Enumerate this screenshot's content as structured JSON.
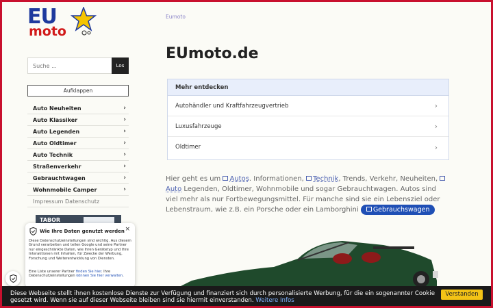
{
  "logo": {
    "line1": "EU",
    "line2": "moto"
  },
  "search": {
    "placeholder": "Suche ...",
    "button": "Los"
  },
  "sidebar": {
    "expand_label": "Aufklappen",
    "items": [
      {
        "label": "Auto Neuheiten"
      },
      {
        "label": "Auto Klassiker"
      },
      {
        "label": "Auto Legenden"
      },
      {
        "label": "Auto Oldtimer"
      },
      {
        "label": "Auto Technik"
      },
      {
        "label": "Straßenverkehr"
      },
      {
        "label": "Gebrauchtwagen"
      },
      {
        "label": "Wohnmobile Camper"
      },
      {
        "label": "Impressum Datenschutz"
      }
    ],
    "ad_text": "TABOR"
  },
  "main": {
    "breadcrumb": "Eumoto",
    "title": "EUmoto.de",
    "more_box": {
      "heading": "Mehr entdecken",
      "items": [
        {
          "label": "Autohändler und Kraftfahrzeugvertrieb"
        },
        {
          "label": "Luxusfahrzeuge"
        },
        {
          "label": "Oldtimer"
        }
      ]
    },
    "intro": {
      "p1": "Hier geht es um ",
      "link1": "Autos",
      "p2": ". Informationen, ",
      "link2": "Technik",
      "p3": ", Trends, Verkehr, Neuheiten, ",
      "link3": "Auto",
      "p4": " Legenden, Oldtimer, Wohnmobile und sogar Gebrauchtwagen. Autos sind viel mehr als nur Fortbewegungsmittel. Für manche sind sie ein Lebensziel oder Lebenstraum, wie z.B. ein Porsche oder ein Lamborghini ",
      "pill": "Gebrauchswagen"
    }
  },
  "consent": {
    "title": "Wie Ihre Daten genutzt werden",
    "close": "×",
    "body": "Diese Datenschutzeinstellungen sind wichtig. Aus diesem Grund verarbeiten und teilen Google und seine Partner nur eingeschränkte Daten, wie Ihren Gerätetyp und Ihre Interaktionen mit Inhalten, für Zwecke der Werbung, Forschung und Weiterentwicklung von Diensten.",
    "list_pre": "Eine Liste unserer Partner ",
    "list_link1": "finden Sie hier",
    "list_mid": ". Ihre Datenschutzeinstellungen ",
    "list_link2": "können Sie hier verwalten",
    "list_post": "."
  },
  "cookiebar": {
    "text": "Diese Webseite stellt ihnen kostenlose Dienste zur Verfügung und finanziert sich durch personalisierte Werbung, für die ein sogenannter Cookie gesetzt wird. Wenn sie auf dieser Webseite bleiben sind sie hiermit einverstanden. ",
    "link": "Weitere Infos",
    "button": "Verstanden"
  },
  "colors": {
    "accent_red": "#c8102e",
    "brand_blue": "#1f3a9e",
    "button_yellow": "#f3c316",
    "pill_blue": "#1f4fb5"
  }
}
